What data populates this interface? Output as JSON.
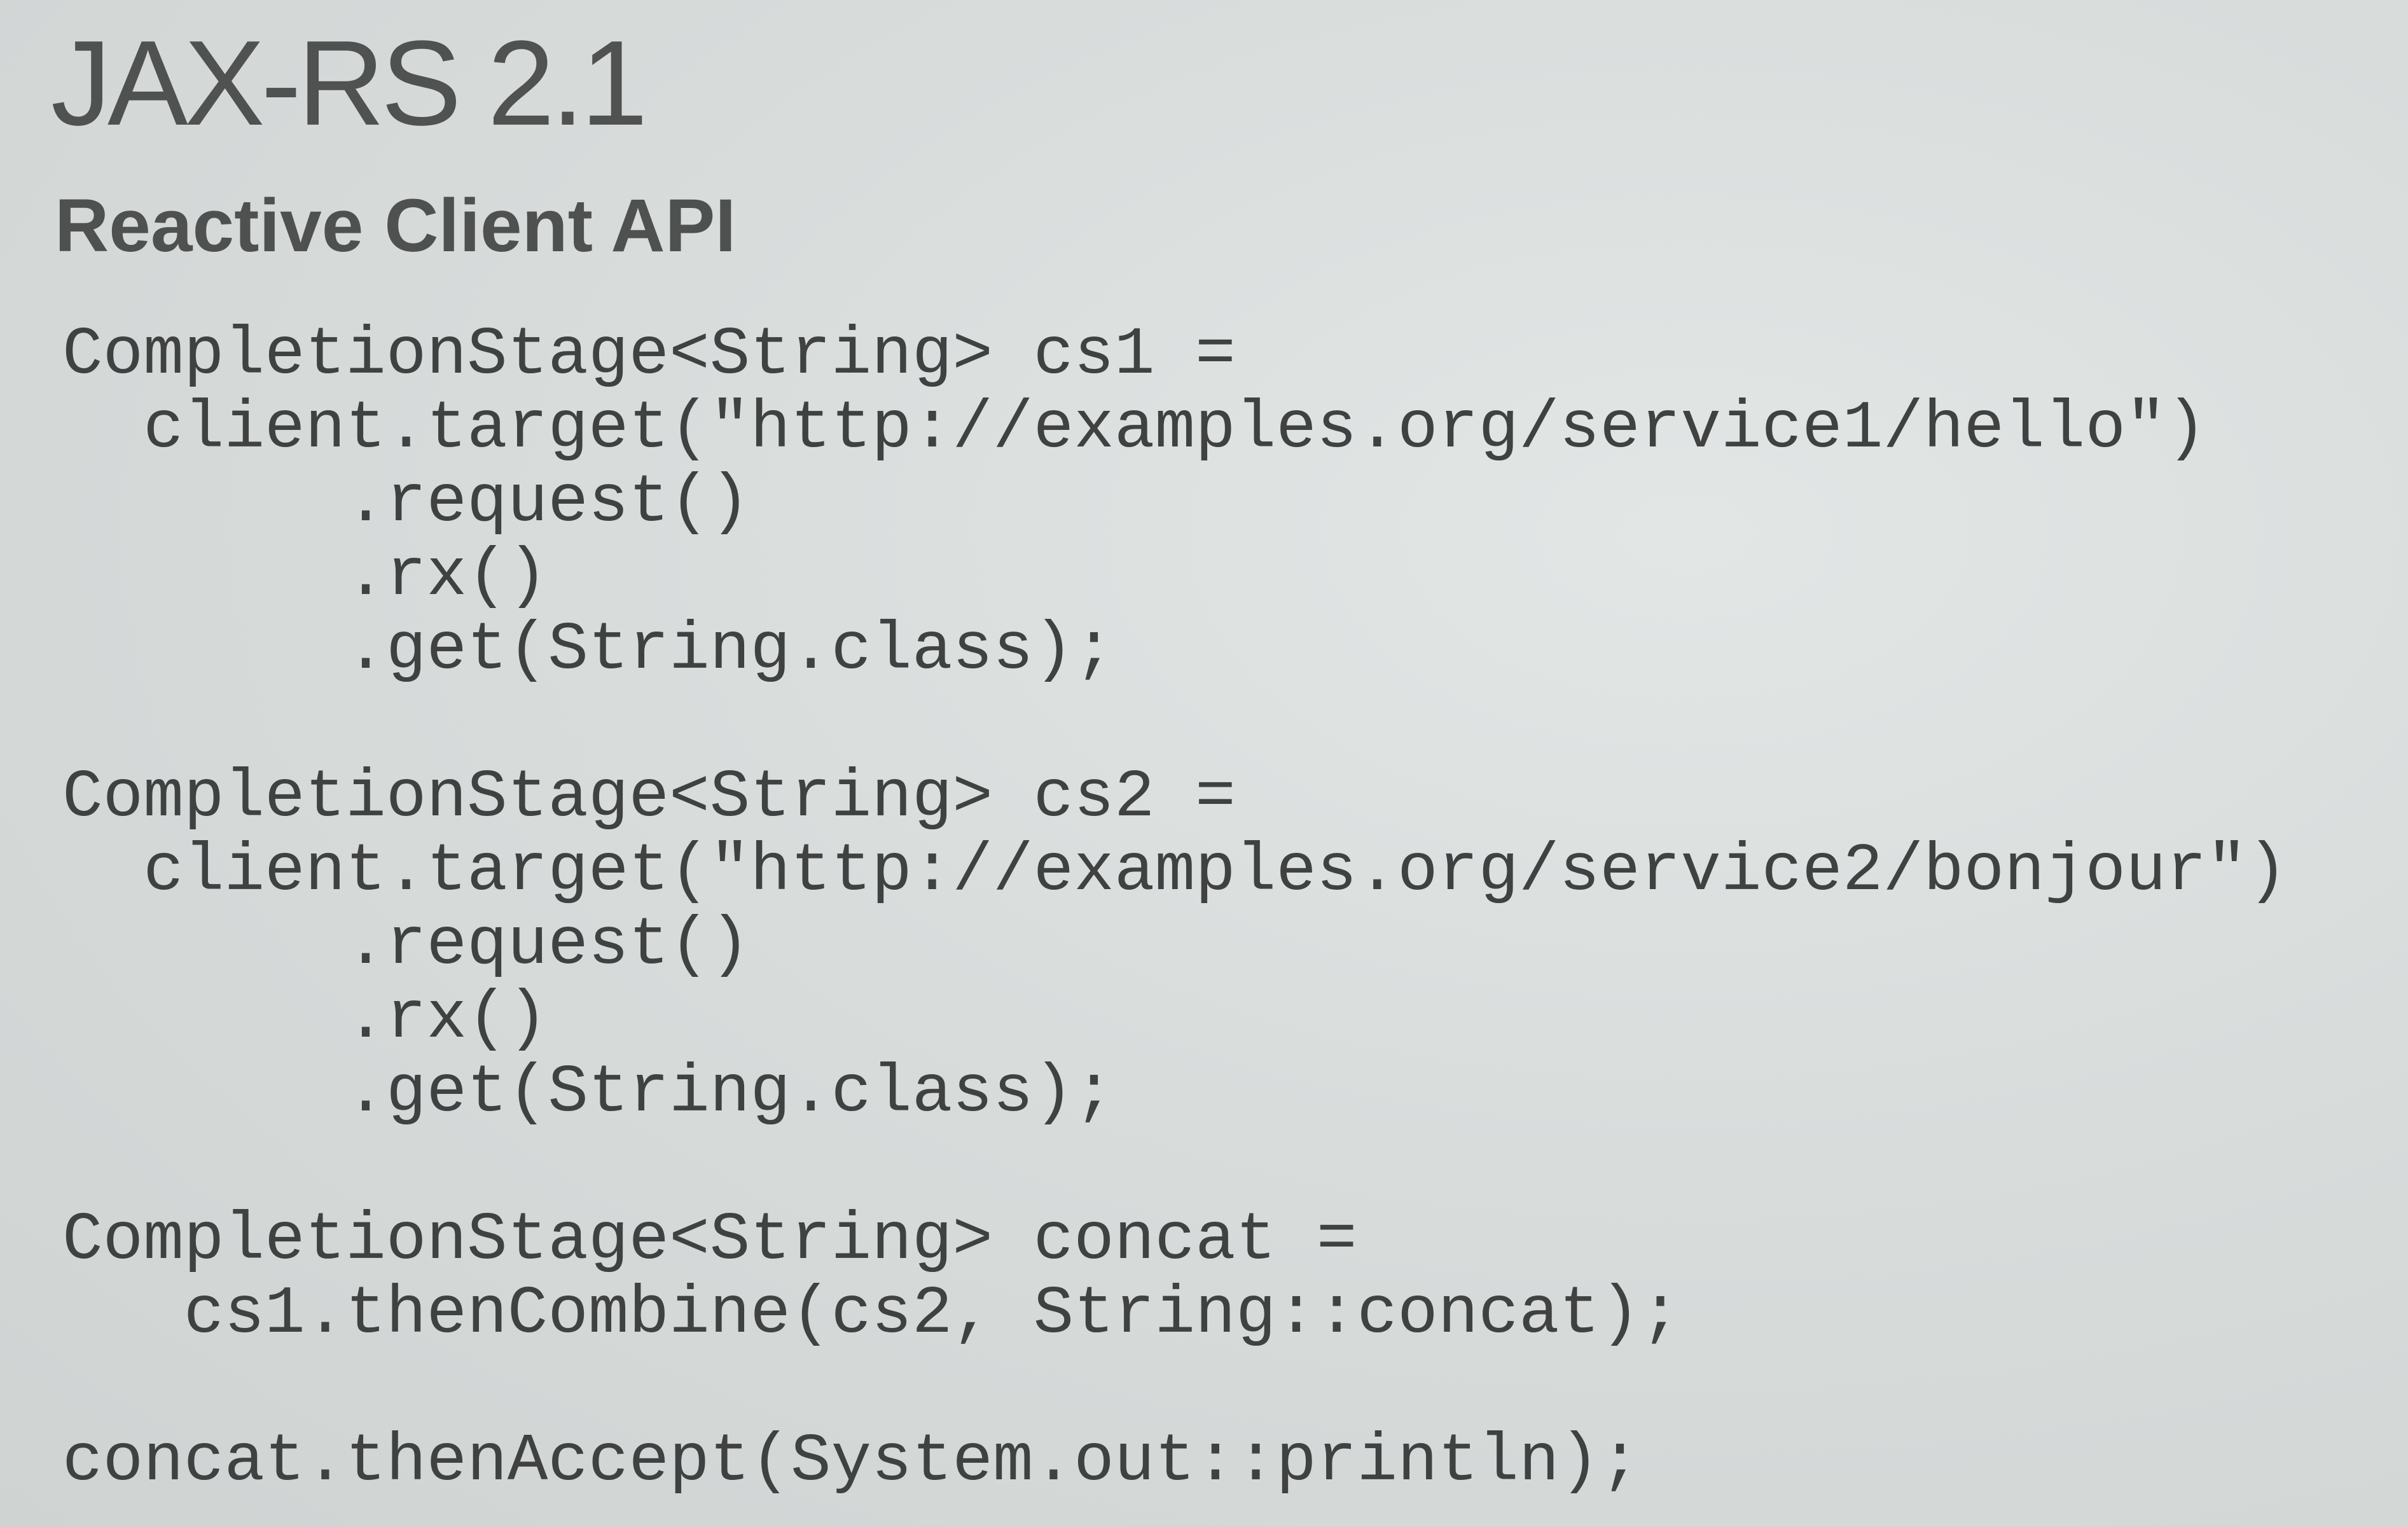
{
  "slide": {
    "title": "JAX-RS 2.1",
    "subtitle": "Reactive Client API",
    "code_lines": [
      "CompletionStage<String> cs1 =",
      "  client.target(\"http://examples.org/service1/hello\")",
      "       .request()",
      "       .rx()",
      "       .get(String.class);",
      "",
      "CompletionStage<String> cs2 =",
      "  client.target(\"http://examples.org/service2/bonjour\")",
      "       .request()",
      "       .rx()",
      "       .get(String.class);",
      "",
      "CompletionStage<String> concat =",
      "   cs1.thenCombine(cs2, String::concat);",
      "",
      "concat.thenAccept(System.out::println);"
    ]
  }
}
